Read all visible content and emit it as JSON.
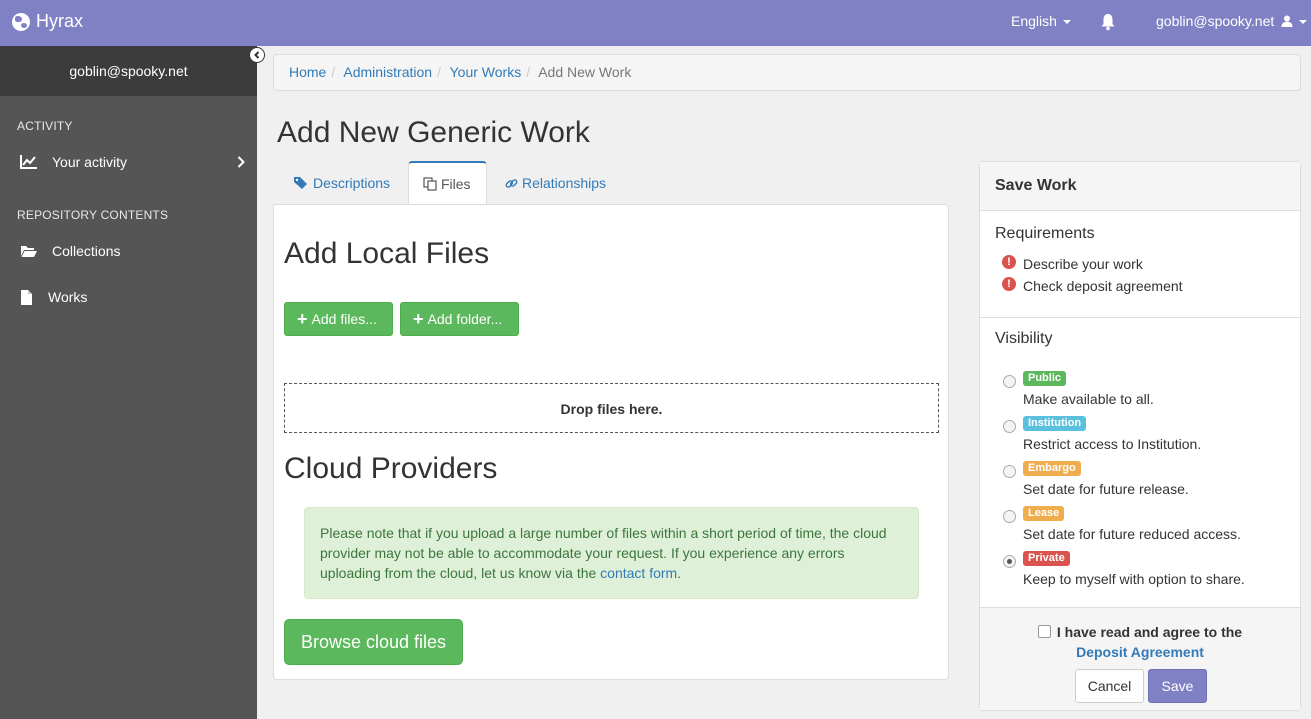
{
  "app": {
    "name": "Hyrax"
  },
  "topnav": {
    "language": "English",
    "user": "goblin@spooky.net"
  },
  "sidebar": {
    "user": "goblin@spooky.net",
    "sections": [
      {
        "label": "ACTIVITY",
        "items": [
          {
            "label": "Your activity"
          }
        ]
      },
      {
        "label": "REPOSITORY CONTENTS",
        "items": [
          {
            "label": "Collections"
          },
          {
            "label": "Works"
          }
        ]
      }
    ]
  },
  "breadcrumb": {
    "items": [
      "Home",
      "Administration",
      "Your Works"
    ],
    "active": "Add New Work"
  },
  "page": {
    "title": "Add New Generic Work"
  },
  "tabs": [
    {
      "label": "Descriptions",
      "icon": "tags-icon"
    },
    {
      "label": "Files",
      "icon": "copy-icon"
    },
    {
      "label": "Relationships",
      "icon": "link-icon"
    }
  ],
  "files": {
    "local_heading": "Add Local Files",
    "add_files": "Add files...",
    "add_folder": "Add folder...",
    "dropzone": "Drop files here.",
    "cloud_heading": "Cloud Providers",
    "cloud_notice": "Please note that if you upload a large number of files within a short period of time, the cloud provider may not be able to accommodate your request. If you experience any errors uploading from the cloud, let us know via the ",
    "cloud_notice_link": "contact form",
    "cloud_notice_end": ".",
    "browse_button": "Browse cloud files"
  },
  "save_panel": {
    "heading": "Save Work",
    "requirements_label": "Requirements",
    "requirements": [
      "Describe your work",
      "Check deposit agreement"
    ],
    "visibility_label": "Visibility",
    "visibility": [
      {
        "badge": "Public",
        "desc": "Make available to all.",
        "color": "#5cb85c",
        "selected": false
      },
      {
        "badge": "Institution",
        "desc": "Restrict access to Institution.",
        "color": "#5bc0de",
        "selected": false
      },
      {
        "badge": "Embargo",
        "desc": "Set date for future release.",
        "color": "#f0ad4e",
        "selected": false
      },
      {
        "badge": "Lease",
        "desc": "Set date for future reduced access.",
        "color": "#f0ad4e",
        "selected": false
      },
      {
        "badge": "Private",
        "desc": "Keep to myself with option to share.",
        "color": "#d9534f",
        "selected": true
      }
    ],
    "agreement_text": "I have read and agree to the",
    "agreement_link": "Deposit Agreement",
    "cancel": "Cancel",
    "save": "Save"
  },
  "colors": {
    "brand": "#8080c4",
    "sidebar": "#555555",
    "link": "#337ab7",
    "success": "#5cb85c",
    "danger": "#d9534f"
  }
}
